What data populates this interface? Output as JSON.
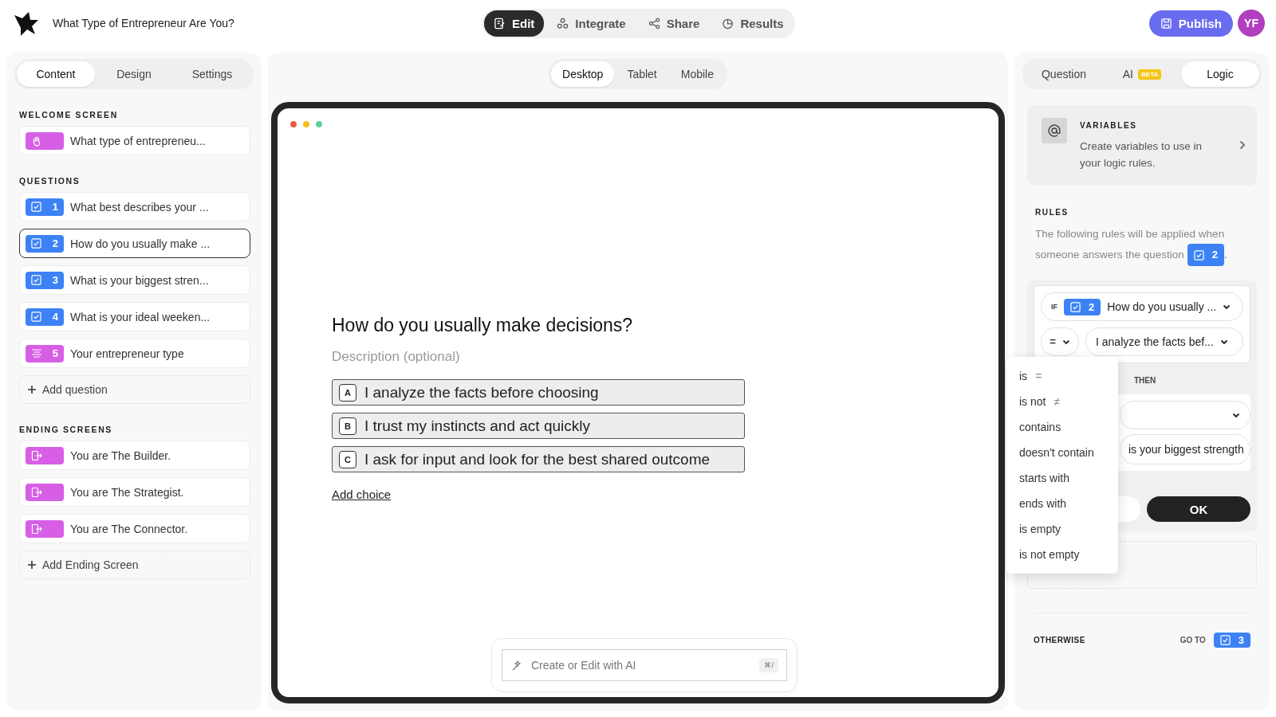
{
  "app": {
    "title": "What Type of Entrepreneur Are You?"
  },
  "nav_tabs": [
    {
      "label": "Edit",
      "kind": "edit",
      "selected": true
    },
    {
      "label": "Integrate",
      "kind": "integrate",
      "selected": false
    },
    {
      "label": "Share",
      "kind": "share",
      "selected": false
    },
    {
      "label": "Results",
      "kind": "results",
      "selected": false
    }
  ],
  "publish_button": "Publish",
  "avatar": "YF",
  "left_tabs": [
    {
      "label": "Content",
      "selected": true
    },
    {
      "label": "Design",
      "selected": false
    },
    {
      "label": "Settings",
      "selected": false
    }
  ],
  "sections": [
    {
      "heading": "WELCOME SCREEN",
      "items": [
        {
          "kind": "welcome",
          "label": "What type of entrepreneu...",
          "selected": false
        }
      ]
    },
    {
      "heading": "QUESTIONS",
      "add": "Add question",
      "items": [
        {
          "kind": "choice",
          "number": "1",
          "label": "What best describes your ...",
          "selected": false
        },
        {
          "kind": "choice",
          "number": "2",
          "label": "How do you usually make ...",
          "selected": true
        },
        {
          "kind": "choice",
          "number": "3",
          "label": "What is your biggest stren...",
          "selected": false
        },
        {
          "kind": "choice",
          "number": "4",
          "label": "What is your ideal weeken...",
          "selected": false
        },
        {
          "kind": "statement",
          "number": "5",
          "label": "Your entrepreneur type",
          "selected": false
        }
      ]
    },
    {
      "heading": "ENDING SCREENS",
      "add": "Add Ending Screen",
      "items": [
        {
          "kind": "ending",
          "label": "You are The Builder.",
          "selected": false
        },
        {
          "kind": "ending",
          "label": "You are The Strategist.",
          "selected": false
        },
        {
          "kind": "ending",
          "label": "You are The Connector.",
          "selected": false
        }
      ]
    }
  ],
  "device_tabs": [
    {
      "label": "Desktop",
      "selected": true
    },
    {
      "label": "Tablet",
      "selected": false
    },
    {
      "label": "Mobile",
      "selected": false
    }
  ],
  "preview": {
    "question": "How do you usually make decisions?",
    "description_placeholder": "Description (optional)",
    "choices": [
      {
        "letter": "A",
        "label": "I analyze the facts before choosing"
      },
      {
        "letter": "B",
        "label": "I trust my instincts and act quickly"
      },
      {
        "letter": "C",
        "label": "I ask for input and look for the best shared outcome"
      }
    ],
    "add_choice": "Add choice"
  },
  "ai_field": {
    "placeholder": "Create or Edit with AI",
    "shortcut": "⌘/"
  },
  "right_tabs": [
    {
      "label": "Question",
      "selected": false
    },
    {
      "label": "AI",
      "badge": "BETA",
      "selected": false
    },
    {
      "label": "Logic",
      "selected": true
    }
  ],
  "variables": {
    "heading": "VARIABLES",
    "text": "Create variables to use in your logic rules."
  },
  "rules": {
    "heading": "RULES",
    "intro": [
      "The following rules will be applied when",
      "someone answers the question"
    ],
    "question_number": "2",
    "intro_end": "."
  },
  "rule": {
    "if_label": "IF",
    "question_number": "2",
    "question": "How do you usually ...",
    "operator": "=",
    "answer": "I analyze the facts bef...",
    "then_label": "THEN",
    "target_text": "is your biggest strength",
    "ok": "OK"
  },
  "operator_menu": [
    {
      "label": "is",
      "symbol": "="
    },
    {
      "label": "is not",
      "symbol": "≠"
    },
    {
      "label": "contains"
    },
    {
      "label": "doesn't contain"
    },
    {
      "label": "starts with"
    },
    {
      "label": "ends with"
    },
    {
      "label": "is empty"
    },
    {
      "label": "is not empty"
    }
  ],
  "otherwise": {
    "label": "OTHERWISE",
    "goto_label": "GO TO",
    "question_number": "3"
  }
}
